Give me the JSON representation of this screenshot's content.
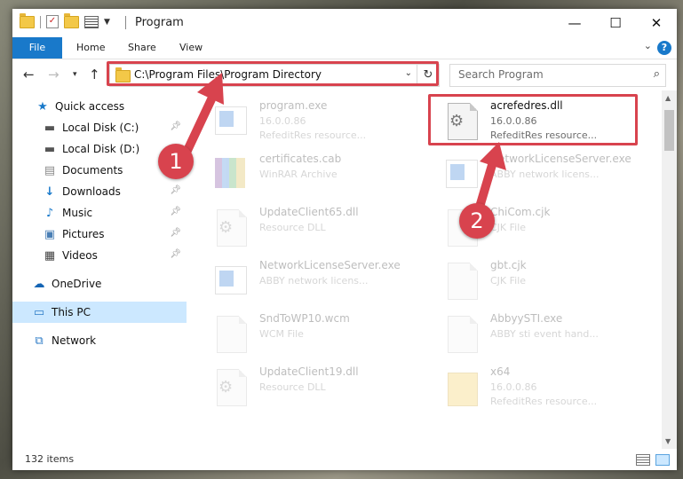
{
  "window": {
    "title": "Program",
    "controls": {
      "minimize": "—",
      "maximize": "☐",
      "close": "✕"
    }
  },
  "ribbon": {
    "tabs": [
      {
        "label": "File"
      },
      {
        "label": "Home"
      },
      {
        "label": "Share"
      },
      {
        "label": "View"
      }
    ],
    "help": "?"
  },
  "nav": {
    "address": "C:\\Program Files\\Program Directory",
    "search_placeholder": "Search Program"
  },
  "sidebar": {
    "items": [
      {
        "label": "Quick access",
        "icon": "star-icon"
      },
      {
        "label": "Local Disk (C:)",
        "icon": "drive-icon",
        "pinned": true
      },
      {
        "label": "Local Disk (D:)",
        "icon": "drive-icon"
      },
      {
        "label": "Documents",
        "icon": "documents-icon",
        "pinned": true
      },
      {
        "label": "Downloads",
        "icon": "download-icon",
        "pinned": true
      },
      {
        "label": "Music",
        "icon": "music-icon",
        "pinned": true
      },
      {
        "label": "Pictures",
        "icon": "pictures-icon",
        "pinned": true
      },
      {
        "label": "Videos",
        "icon": "videos-icon",
        "pinned": true
      },
      {
        "label": "OneDrive",
        "icon": "cloud-icon"
      },
      {
        "label": "This PC",
        "icon": "computer-icon",
        "selected": true
      },
      {
        "label": "Network",
        "icon": "network-icon"
      }
    ]
  },
  "files": [
    {
      "name": "program.exe",
      "line1": "16.0.0.86",
      "line2": "RefeditRes resource..."
    },
    {
      "name": "acrefedres.dll",
      "line1": "16.0.0.86",
      "line2": "RefeditRes resource..."
    },
    {
      "name": "certificates.cab",
      "line1": "WinRAR Archive",
      "line2": ""
    },
    {
      "name": "NetworkLicenseServer.exe",
      "line1": "ABBY network licens...",
      "line2": ""
    },
    {
      "name": "UpdateClient65.dll",
      "line1": "Resource DLL",
      "line2": ""
    },
    {
      "name": "ChiCom.cjk",
      "line1": "CJK File",
      "line2": ""
    },
    {
      "name": "NetworkLicenseServer.exe",
      "line1": "ABBY network licens...",
      "line2": ""
    },
    {
      "name": "gbt.cjk",
      "line1": "CJK File",
      "line2": ""
    },
    {
      "name": "SndToWP10.wcm",
      "line1": "WCM File",
      "line2": ""
    },
    {
      "name": "AbbyySTI.exe",
      "line1": "ABBY sti event hand...",
      "line2": ""
    },
    {
      "name": "UpdateClient19.dll",
      "line1": "Resource DLL",
      "line2": ""
    },
    {
      "name": "x64",
      "line1": "16.0.0.86",
      "line2": "RefeditRes resource..."
    }
  ],
  "status": {
    "items": "132 items"
  },
  "annotations": {
    "step1": "1",
    "step2": "2"
  }
}
